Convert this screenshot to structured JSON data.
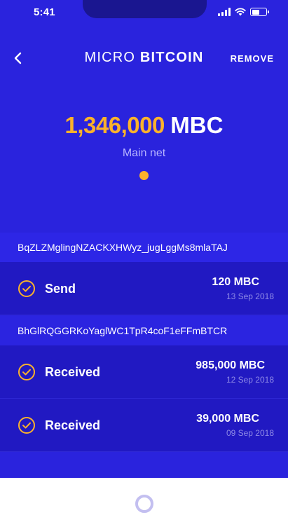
{
  "status_bar": {
    "time": "5:41"
  },
  "header": {
    "title_light": "MICRO",
    "title_bold": "BITCOIN",
    "remove_label": "REMOVE"
  },
  "balance": {
    "amount": "1,346,000",
    "unit": "MBC",
    "network": "Main net"
  },
  "transactions": [
    {
      "address": "BqZLZMglingNZACKXHWyz_jugLggMs8mlaTAJ",
      "items": [
        {
          "type": "Send",
          "amount": "120 MBC",
          "date": "13 Sep 2018"
        }
      ]
    },
    {
      "address": "BhGlRQGGRKoYaglWC1TpR4coF1eFFmBTCR",
      "items": [
        {
          "type": "Received",
          "amount": "985,000 MBC",
          "date": "12 Sep 2018"
        },
        {
          "type": "Received",
          "amount": "39,000 MBC",
          "date": "09 Sep 2018"
        }
      ]
    }
  ],
  "colors": {
    "background": "#2a23dd",
    "accent": "#fcb22b",
    "row": "#2119c2"
  }
}
